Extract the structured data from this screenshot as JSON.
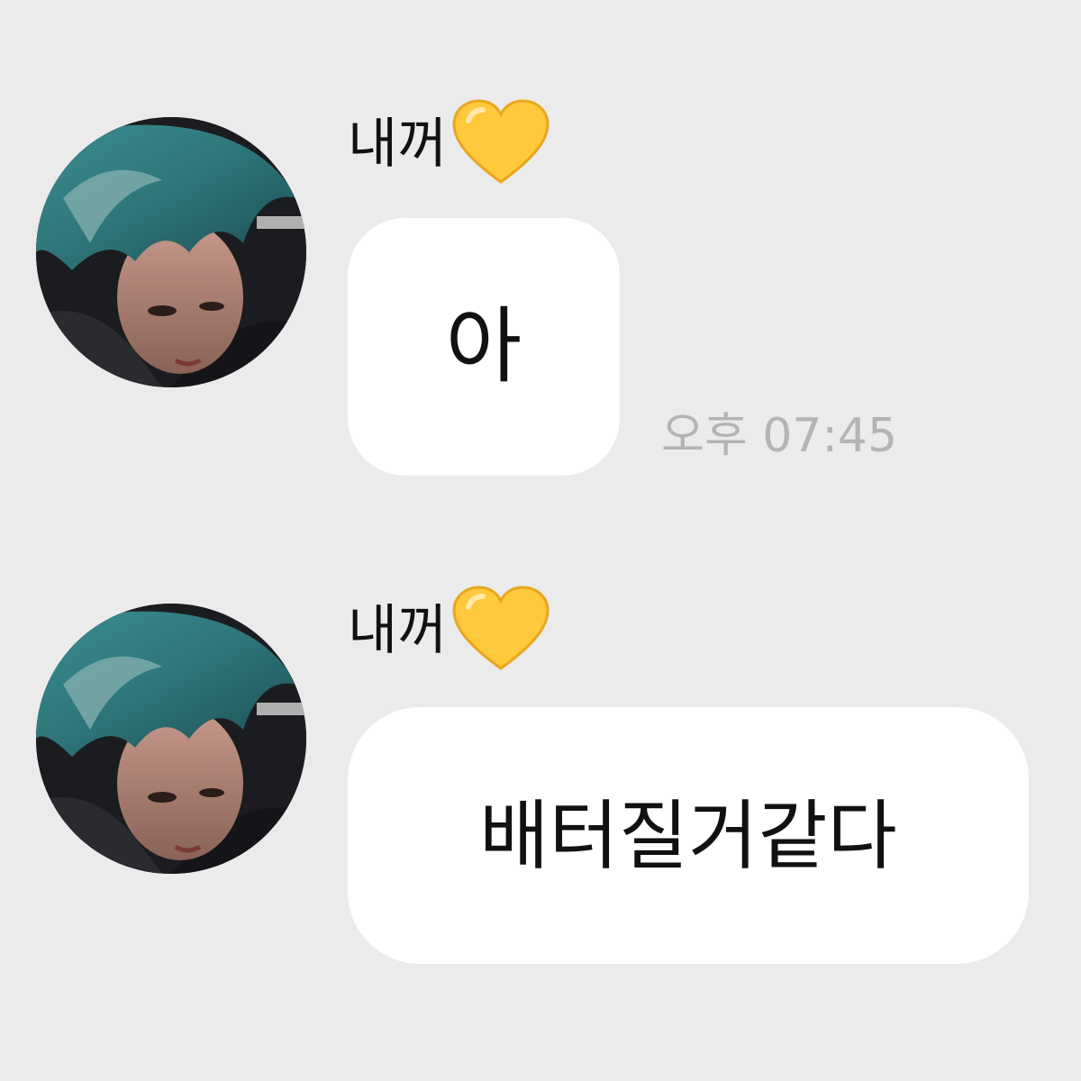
{
  "background_color": "#ebebeb",
  "heart_color": "#ffc83d",
  "timestamp_color": "#b4b4b4",
  "messages": [
    {
      "sender": "내꺼",
      "sender_emoji": "yellow-heart-icon",
      "avatar": "profile-avatar",
      "text": "아",
      "time": "오후 07:45"
    },
    {
      "sender": "내꺼",
      "sender_emoji": "yellow-heart-icon",
      "avatar": "profile-avatar",
      "text": "배터질거같다"
    }
  ]
}
